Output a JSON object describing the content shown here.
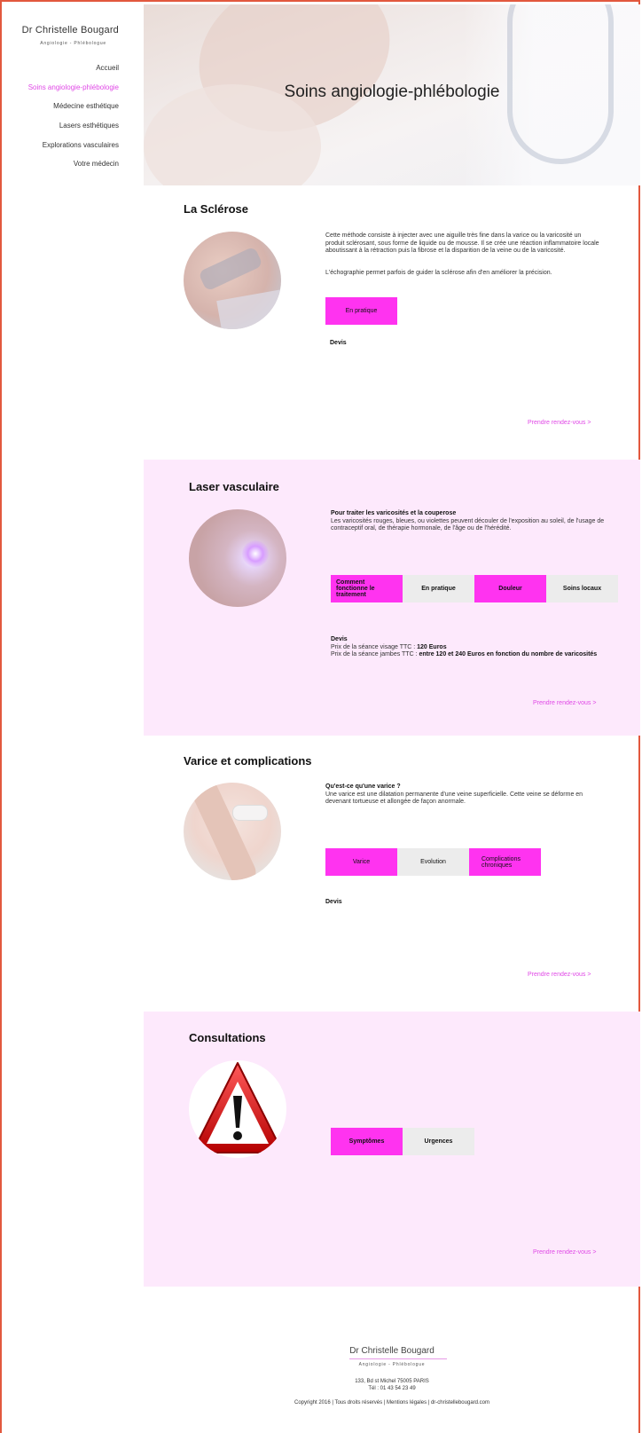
{
  "brand": {
    "name": "Dr Christelle Bougard",
    "tagline": "Angiologie - Phlébologue"
  },
  "nav": {
    "items": [
      {
        "label": "Accueil",
        "active": false
      },
      {
        "label": "Soins angiologie-phlébologie",
        "active": true
      },
      {
        "label": "Médecine esthétique",
        "active": false
      },
      {
        "label": "Lasers esthétiques",
        "active": false
      },
      {
        "label": "Explorations vasculaires",
        "active": false
      },
      {
        "label": "Votre médecin",
        "active": false
      }
    ]
  },
  "hero": {
    "title": "Soins angiologie-phlébologie"
  },
  "sclerose": {
    "title": "La Sclérose",
    "paragraph1": "Cette méthode consiste à injecter avec une aiguille très fine dans la varice ou la varicosité un produit sclérosant, sous forme de liquide ou de mousse. Il se crée  une réaction inflammatoire locale aboutissant à la rétraction puis la fibrose et la disparition de la veine ou de la varicosité.",
    "paragraph2": "L'échographie permet parfois de guider la sclérose afin d'en améliorer la précision.",
    "button": "En pratique",
    "devis": "Devis",
    "rdv": "Prendre rendez-vous >"
  },
  "laser": {
    "title": "Laser vasculaire",
    "heading": "Pour traiter les varicosités et la couperose",
    "paragraph": "Les varicosités rouges, bleues, ou violettes peuvent découler de l'exposition au soleil, de l'usage de contraceptif oral, de thérapie hormonale, de l'âge ou de l'hérédité.",
    "tabs": [
      "Comment fonctionne le traitement",
      "En pratique",
      "Douleur",
      "Soins locaux"
    ],
    "devis": "Devis",
    "price_visage_label": "Prix de la séance visage  TTC : ",
    "price_visage_value": "120 Euros",
    "price_jambes_label": "Prix de la séance jambes TTC : ",
    "price_jambes_value": "entre 120 et 240 Euros en fonction du nombre de varicosités",
    "rdv": "Prendre rendez-vous >"
  },
  "varice": {
    "title": "Varice et complications",
    "heading": "Qu'est-ce qu'une varice ?",
    "paragraph": "Une varice est une dilatation permanente d'une veine superficielle. Cette veine se déforme en devenant tortueuse et allongée de façon anormale.",
    "tabs": [
      "Varice",
      "Evolution",
      "Complications chroniques"
    ],
    "devis": "Devis",
    "rdv": "Prendre rendez-vous >"
  },
  "consultations": {
    "title": "Consultations",
    "tabs": [
      "Symptômes",
      "Urgences"
    ],
    "rdv": "Prendre rendez-vous >"
  },
  "footer": {
    "name": "Dr Christelle Bougard",
    "tagline": "Angiologie - Phlébologue",
    "address": "133, Bd st Michel 75005 PARIS",
    "phone": "Tél : 01 43 54 23 49",
    "copyright": "Copyright 2016 | Tous droits réservés | Mentions légales | dr-christellebougard.com"
  },
  "colors": {
    "accent": "#ff33f0",
    "link": "#e048e6",
    "pinkBg": "#fde9fc",
    "border": "#e2583e"
  }
}
